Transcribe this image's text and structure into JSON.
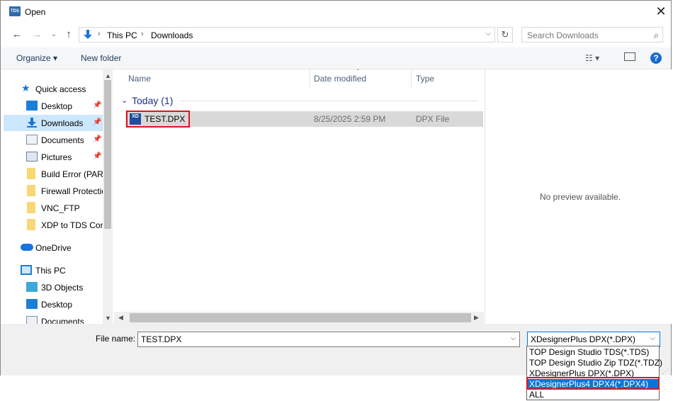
{
  "window": {
    "title": "Open",
    "app_icon_text": "TDS"
  },
  "address": {
    "crumbs": [
      "This PC",
      "Downloads"
    ],
    "search_placeholder": "Search Downloads"
  },
  "toolbar": {
    "organize": "Organize",
    "new_folder": "New folder",
    "help": "?"
  },
  "nav": {
    "items": [
      {
        "label": "Quick access",
        "icon": "star-icon",
        "pinned": false
      },
      {
        "label": "Desktop",
        "icon": "desktop-folder-icon",
        "pinned": true
      },
      {
        "label": "Downloads",
        "icon": "download-arrow-icon",
        "pinned": true,
        "selected": true
      },
      {
        "label": "Documents",
        "icon": "documents-icon",
        "pinned": true
      },
      {
        "label": "Pictures",
        "icon": "pictures-icon",
        "pinned": true
      },
      {
        "label": "Build Error (PARM",
        "icon": "folder-icon"
      },
      {
        "label": "Firewall Protection",
        "icon": "folder-icon"
      },
      {
        "label": "VNC_FTP",
        "icon": "folder-icon"
      },
      {
        "label": "XDP to TDS Conv",
        "icon": "folder-icon"
      },
      {
        "label": "OneDrive",
        "icon": "cloud-icon"
      },
      {
        "label": "This PC",
        "icon": "computer-icon"
      },
      {
        "label": "3D Objects",
        "icon": "cube-icon"
      },
      {
        "label": "Desktop",
        "icon": "desktop-folder-icon"
      },
      {
        "label": "Documents",
        "icon": "documents-icon"
      }
    ]
  },
  "files": {
    "columns": [
      "Name",
      "Date modified",
      "Type"
    ],
    "group": "Today (1)",
    "rows": [
      {
        "name": "TEST.DPX",
        "date": "8/25/2025 2:59 PM",
        "type": "DPX File",
        "icon_text": "XD"
      }
    ]
  },
  "preview": {
    "text": "No preview available."
  },
  "bottom": {
    "file_name_label": "File name:",
    "file_name_value": "TEST.DPX",
    "file_type_selected": "XDesignerPlus DPX(*.DPX)",
    "file_type_options": [
      "TOP Design Studio TDS(*.TDS)",
      "TOP Design Studio Zip TDZ(*.TDZ)",
      "XDesignerPlus DPX(*.DPX)",
      "XDesignerPlus4 DPX4(*.DPX4)",
      "ALL"
    ],
    "highlighted_option_index": 3
  },
  "colors": {
    "accent": "#0078d7",
    "highlight_box": "#e0141e",
    "selection": "#cce8ff"
  }
}
